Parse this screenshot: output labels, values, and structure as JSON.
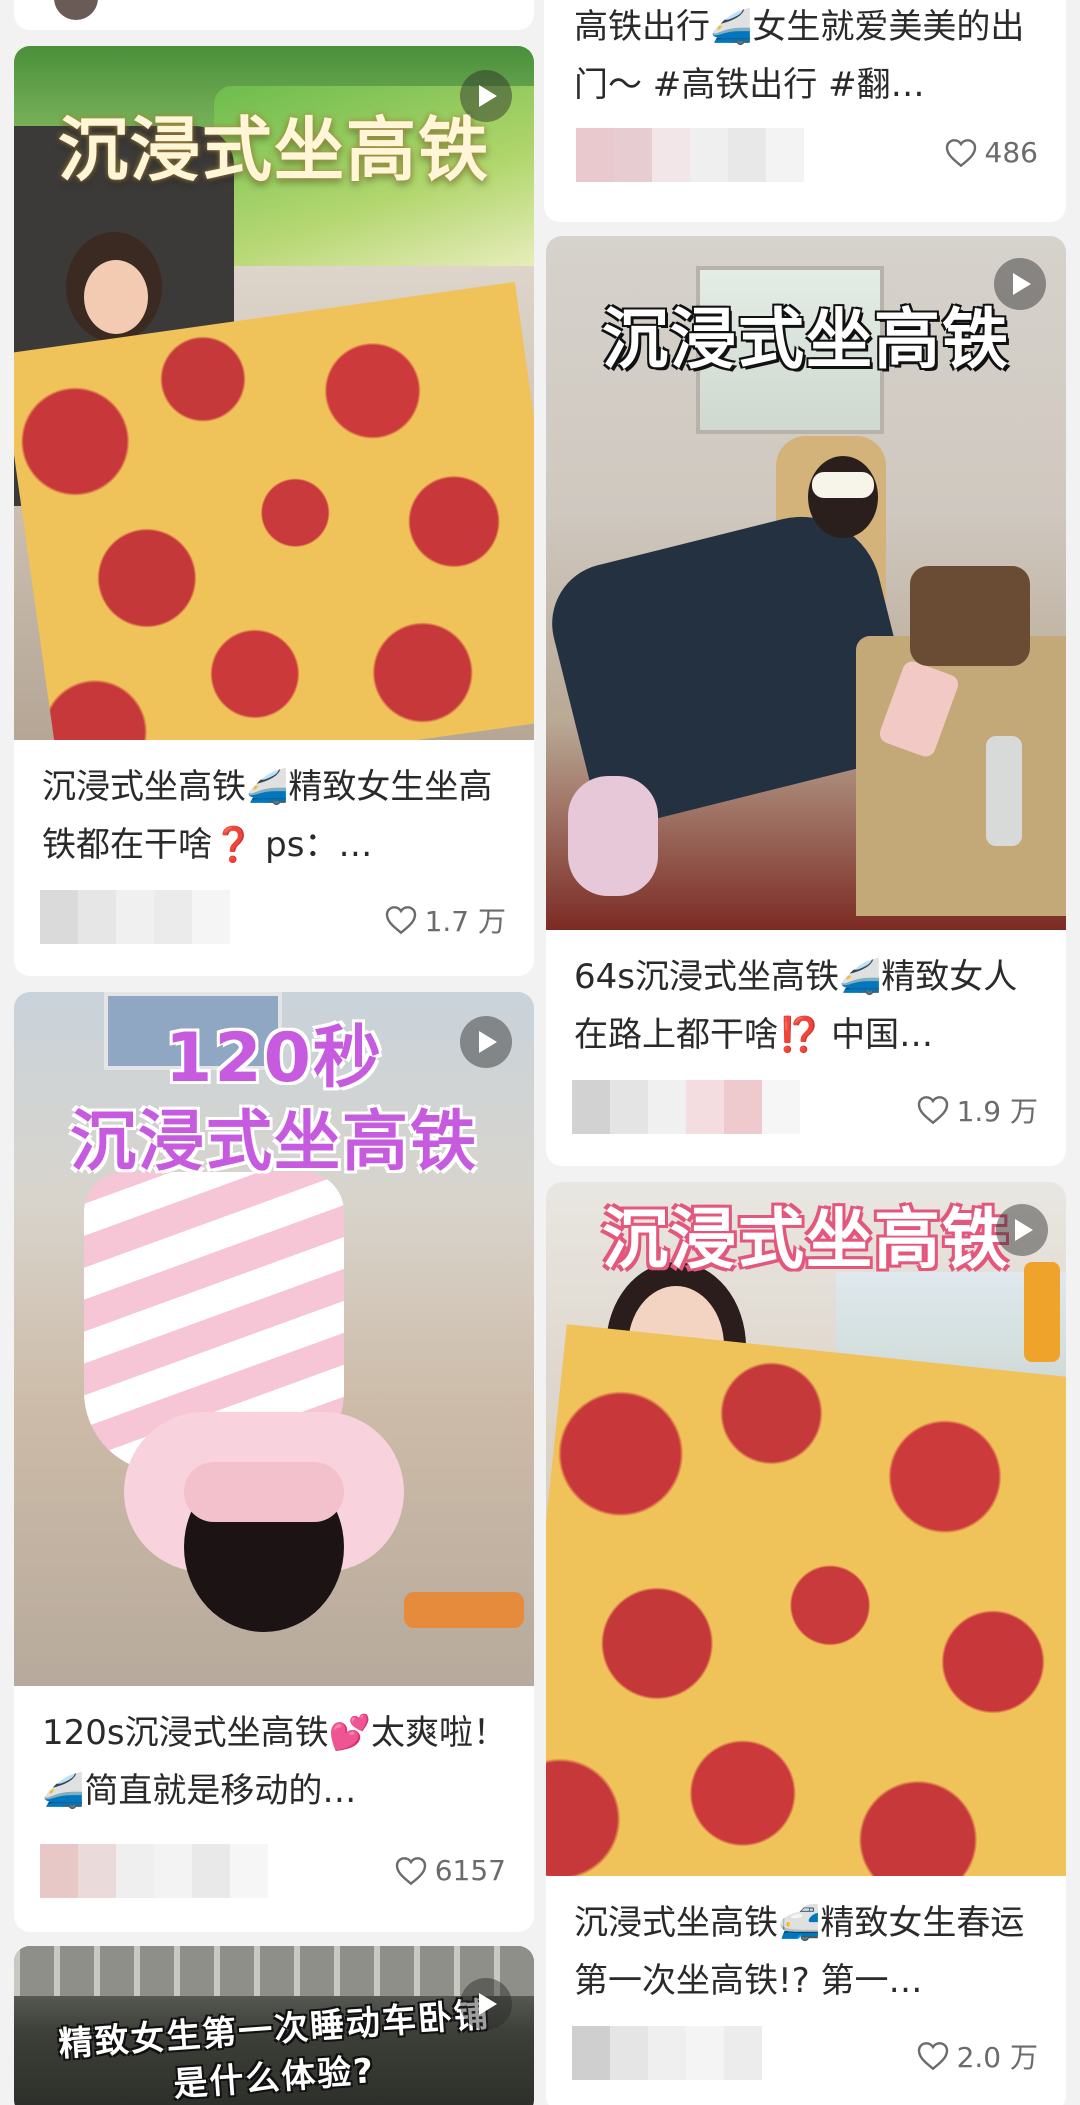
{
  "colors": {
    "background": "#f2f2f2",
    "card": "#ffffff",
    "title_text": "#2a2a2a",
    "likes_text": "#6b6b6b"
  },
  "cards": [
    {
      "id": "c0",
      "title": "高铁出行🚄女生就爱美美的出门～ #高铁出行 #翻…",
      "likes": "486"
    },
    {
      "id": "c1",
      "cover_text": "沉浸式坐高铁",
      "title": "沉浸式坐高铁🚄精致女生坐高铁都在干啥❓ ps：…",
      "likes": "1.7 万"
    },
    {
      "id": "c2",
      "cover_text": "沉浸式坐高铁",
      "title": "64s沉浸式坐高铁🚄精致女人在路上都干啥⁉️ 中国…",
      "likes": "1.9 万"
    },
    {
      "id": "c3",
      "cover_text_line1": "120秒",
      "cover_text_line2": "沉浸式坐高铁",
      "title": "120s沉浸式坐高铁💕太爽啦！ 🚄简直就是移动的…",
      "likes": "6157"
    },
    {
      "id": "c4",
      "cover_text": "沉浸式坐高铁",
      "title": "沉浸式坐高铁🚅精致女生春运第一次坐高铁!? 第一…",
      "likes": "2.0 万"
    },
    {
      "id": "c5",
      "cover_text_line1": "精致女生第一次睡动车卧铺",
      "cover_text_line2": "是什么体验?"
    }
  ],
  "icons": {
    "like": "heart-outline-icon",
    "play": "play-icon"
  }
}
